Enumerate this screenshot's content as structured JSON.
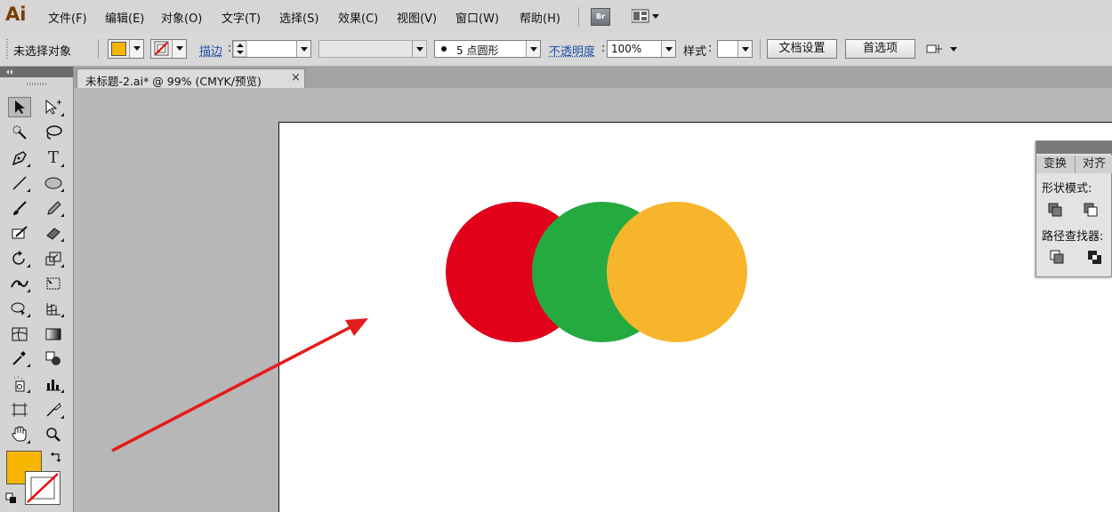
{
  "app": {
    "logo": "Ai"
  },
  "menu": [
    "文件(F)",
    "编辑(E)",
    "对象(O)",
    "文字(T)",
    "选择(S)",
    "效果(C)",
    "视图(V)",
    "窗口(W)",
    "帮助(H)"
  ],
  "menu_extra": {
    "bridge_label": "Br"
  },
  "control_bar": {
    "selection_status": "未选择对象",
    "fill_color": "#f7b500",
    "stroke_label": "描边",
    "brush_value": "5 点圆形",
    "opacity_label": "不透明度",
    "opacity_value": "100%",
    "style_label": "样式",
    "doc_setup_button": "文档设置",
    "preferences_button": "首选项"
  },
  "document_tab": {
    "title": "未标题-2.ai* @ 99% (CMYK/预览)",
    "close": "×"
  },
  "tools": {
    "fill_color": "#f7b500"
  },
  "artwork": {
    "circle_colors": [
      "#e3001b",
      "#24aa3e",
      "#f7b52c"
    ],
    "arrow_color": "#e41c1c"
  },
  "pathfinder_panel": {
    "tabs": [
      "变换",
      "对齐"
    ],
    "shape_modes_label": "形状模式:",
    "pathfinders_label": "路径查找器:"
  }
}
